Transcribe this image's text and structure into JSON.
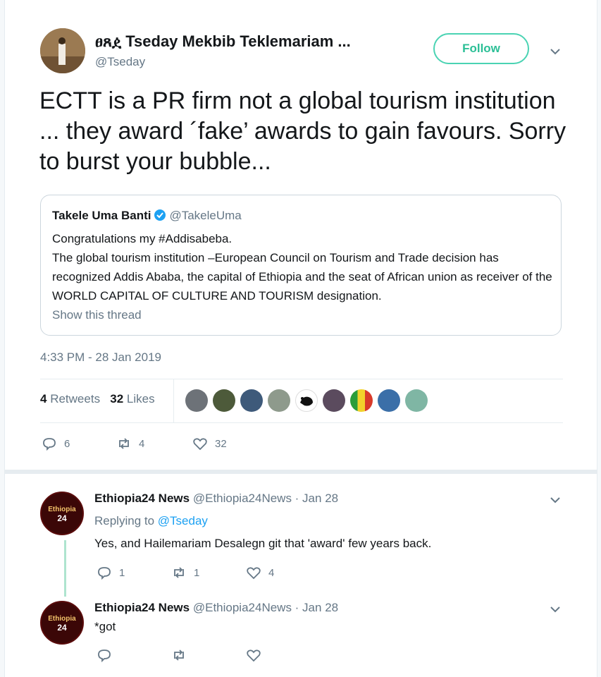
{
  "tweet": {
    "display_name": "ፀጸዸ Tseday Mekbib Teklemariam ...",
    "handle": "@Tseday",
    "follow_label": "Follow",
    "text": "ECTT is a PR firm not a global tourism institution ... they award ´fake’ awards to gain favours. Sorry to burst your bubble...",
    "timestamp": "4:33 PM - 28 Jan 2019",
    "retweets_count": "4",
    "retweets_label": "Retweets",
    "likes_count": "32",
    "likes_label": "Likes",
    "actions": {
      "replies": "6",
      "retweets": "4",
      "likes": "32"
    }
  },
  "quote": {
    "author": "Takele Uma Banti",
    "handle": "@TakeleUma",
    "line1": "Congratulations my #Addisabeba.",
    "line2": "The global tourism institution –European Council on Tourism and Trade decision has recognized Addis Ababa, the capital of Ethiopia and the seat of African union as receiver of the WORLD CAPITAL OF CULTURE AND TOURISM designation.",
    "show_thread": "Show this thread"
  },
  "replies": [
    {
      "name": "Ethiopia24 News",
      "handle_date": "@Ethiopia24News · Jan 28",
      "replying_prefix": "Replying to",
      "replying_handle": "@Tseday",
      "text": "Yes, and Hailemariam Desalegn git that 'award' few years back.",
      "replies": "1",
      "retweets": "1",
      "likes": "4",
      "avatar_text_1": "Ethiopia",
      "avatar_text_2": "24"
    },
    {
      "name": "Ethiopia24 News",
      "handle_date": "@Ethiopia24News · Jan 28",
      "text": "*got",
      "avatar_text_1": "Ethiopia",
      "avatar_text_2": "24"
    }
  ],
  "colors": {
    "accent": "#1da1f2",
    "follow": "#2bbf96",
    "muted": "#657786"
  }
}
